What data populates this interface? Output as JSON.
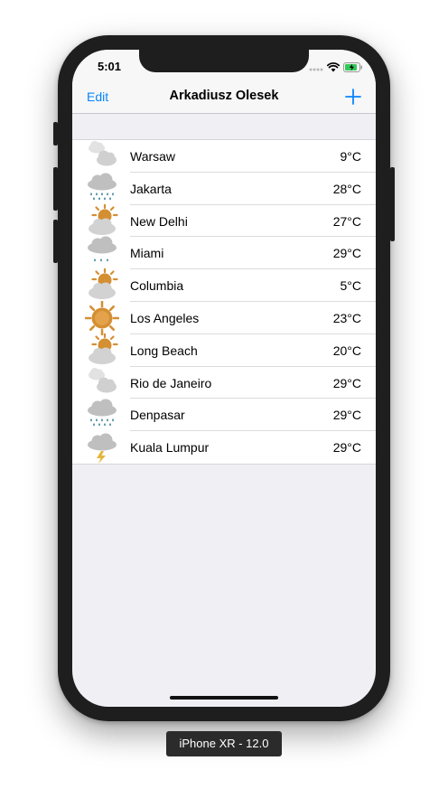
{
  "status_bar": {
    "time": "5:01",
    "icons": [
      "signal-dots-icon",
      "wifi-icon",
      "battery-charging-icon"
    ]
  },
  "nav": {
    "edit_label": "Edit",
    "title": "Arkadiusz Olesek",
    "add_icon": "plus-icon",
    "tint_color": "#0a84ff"
  },
  "cities": [
    {
      "name": "Warsaw",
      "temp": "9°C",
      "icon": "cloudy"
    },
    {
      "name": "Jakarta",
      "temp": "28°C",
      "icon": "heavy-rain"
    },
    {
      "name": "New Delhi",
      "temp": "27°C",
      "icon": "partly-sunny"
    },
    {
      "name": "Miami",
      "temp": "29°C",
      "icon": "light-rain"
    },
    {
      "name": "Columbia",
      "temp": "5°C",
      "icon": "partly-sunny"
    },
    {
      "name": "Los Angeles",
      "temp": "23°C",
      "icon": "sunny"
    },
    {
      "name": "Long Beach",
      "temp": "20°C",
      "icon": "partly-sunny"
    },
    {
      "name": "Rio de Janeiro",
      "temp": "29°C",
      "icon": "cloudy"
    },
    {
      "name": "Denpasar",
      "temp": "29°C",
      "icon": "heavy-rain"
    },
    {
      "name": "Kuala Lumpur",
      "temp": "29°C",
      "icon": "thunderstorm"
    }
  ],
  "device_label": "iPhone XR - 12.0"
}
